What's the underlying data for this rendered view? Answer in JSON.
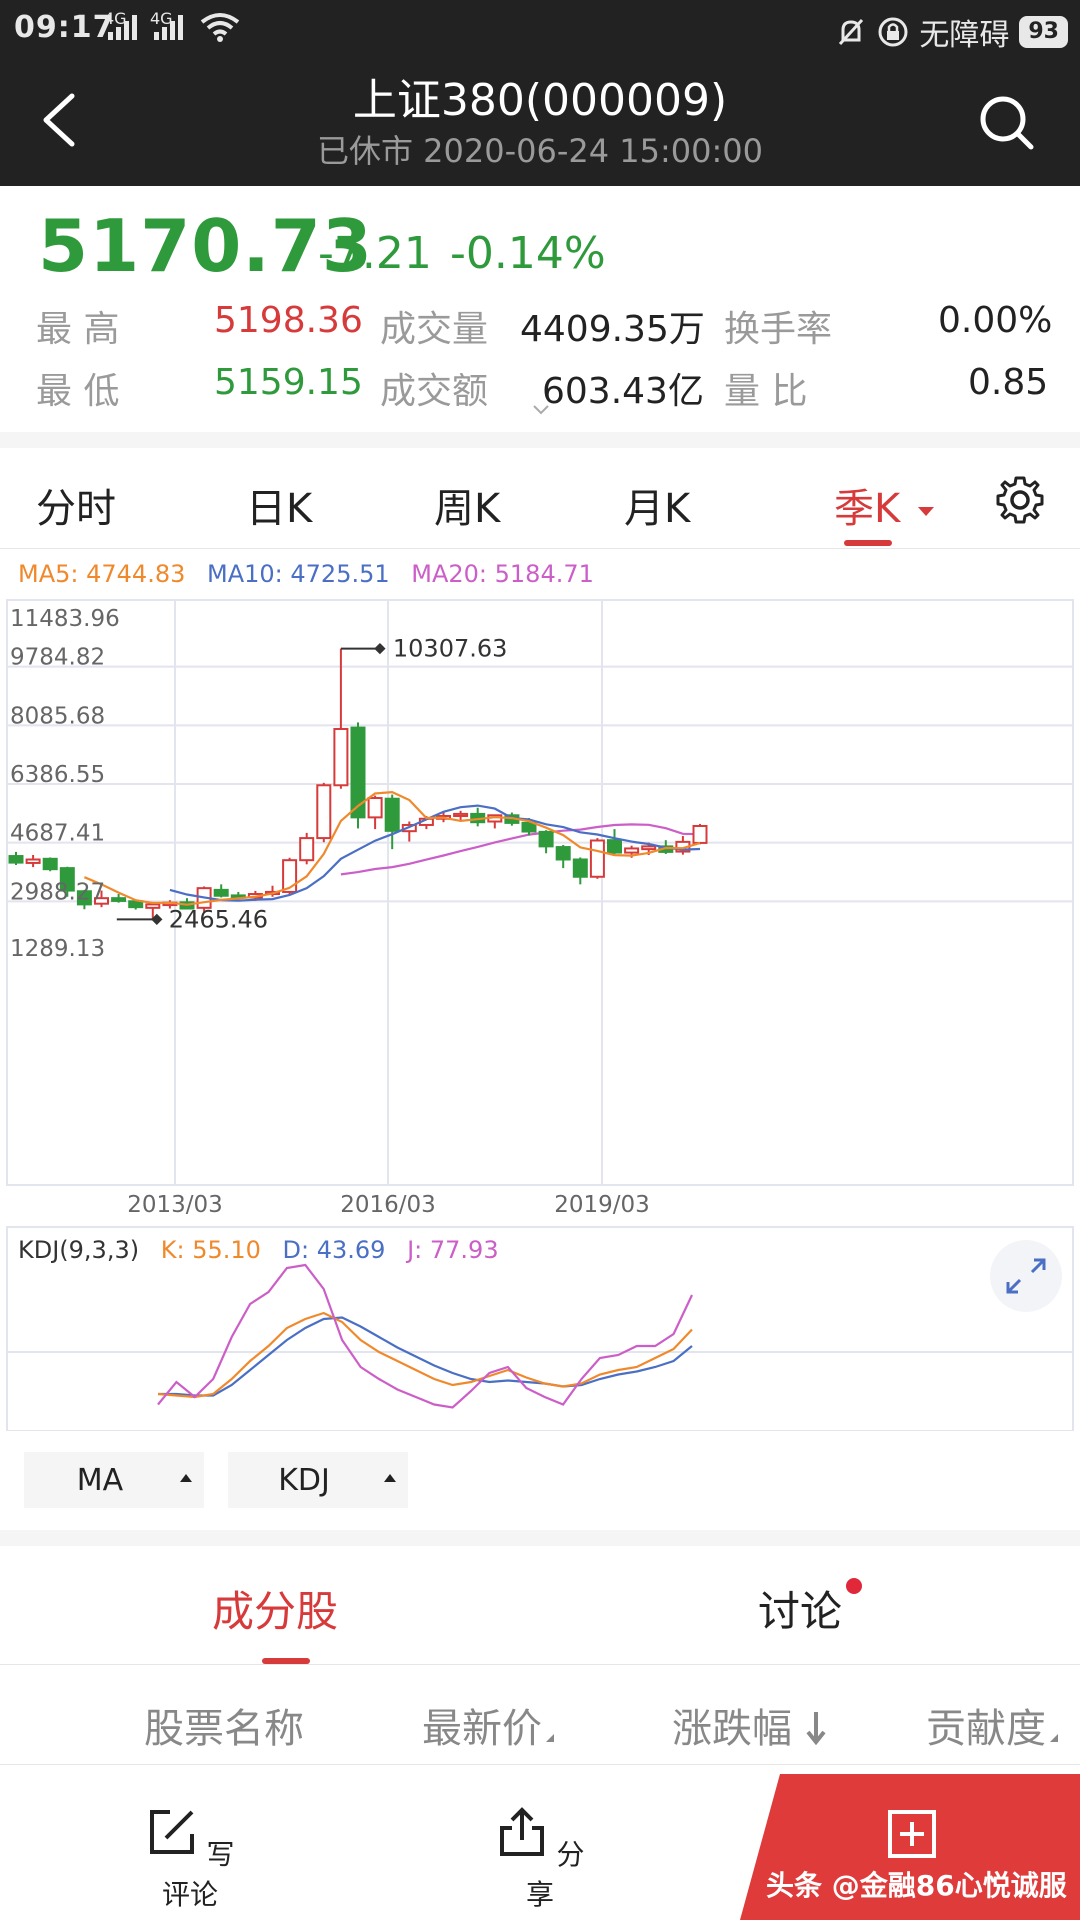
{
  "status_bar": {
    "time": "09:17",
    "network1": "4G",
    "network2": "4G",
    "accessibility_label": "无障碍",
    "battery": "93"
  },
  "header": {
    "title": "上证380(000009)",
    "subtitle": "已休市 2020-06-24 15:00:00"
  },
  "quote": {
    "price": "5170.73",
    "change": "-7.21",
    "change_pct": "-0.14%",
    "high_label": "最    高",
    "high": "5198.36",
    "low_label": "最    低",
    "low": "5159.15",
    "volume_label": "成交量",
    "volume": "4409.35万",
    "amount_label": "成交额",
    "amount": "603.43亿",
    "turnover_label": "换手率",
    "turnover": "0.00%",
    "vol_ratio_label": "量    比",
    "vol_ratio": "0.85"
  },
  "tabs": [
    "分时",
    "日K",
    "周K",
    "月K",
    "季K"
  ],
  "active_tab": "季K",
  "ma_legend": {
    "ma5": "MA5: 4744.83",
    "ma10": "MA10: 4725.51",
    "ma20": "MA20: 5184.71"
  },
  "kdj_legend": {
    "name": "KDJ(9,3,3)",
    "k": "K: 55.10",
    "d": "D: 43.69",
    "j": "J: 77.93"
  },
  "indicator_buttons": {
    "ma": "MA",
    "kdj": "KDJ"
  },
  "lower_tabs": {
    "components": "成分股",
    "discussion": "讨论"
  },
  "columns": [
    "股票名称",
    "最新价",
    "涨跌幅",
    "贡献度"
  ],
  "bottom_bar": {
    "comment": "写评论",
    "share": "分享",
    "watermark": "头条 @金融86心悦诚服"
  },
  "colors": {
    "up": "#d73a3a",
    "down": "#2f9a3c",
    "ma5": "#f0892c",
    "ma10": "#4a6fc4",
    "ma20": "#cc5ec8",
    "header_bg": "#222222"
  },
  "chart_data": {
    "type": "candlestick",
    "period": "quarterly",
    "y_ticks": [
      "11483.96",
      "9784.82",
      "8085.68",
      "6386.55",
      "4687.41",
      "2988.27",
      "1289.13"
    ],
    "ylim": [
      1289.13,
      11483.96
    ],
    "x_ticks": [
      "2013/03",
      "2016/03",
      "2019/03"
    ],
    "annotations": {
      "max": "10307.63",
      "min": "2465.46"
    },
    "candles": [
      {
        "o": 4300,
        "h": 4420,
        "l": 4040,
        "c": 4110
      },
      {
        "o": 4100,
        "h": 4330,
        "l": 3980,
        "c": 4200
      },
      {
        "o": 4220,
        "h": 4260,
        "l": 3860,
        "c": 3920
      },
      {
        "o": 3950,
        "h": 3990,
        "l": 3120,
        "c": 3300
      },
      {
        "o": 3280,
        "h": 3320,
        "l": 2760,
        "c": 2900
      },
      {
        "o": 2920,
        "h": 3300,
        "l": 2820,
        "c": 3080
      },
      {
        "o": 3080,
        "h": 3200,
        "l": 2950,
        "c": 3000
      },
      {
        "o": 2990,
        "h": 3020,
        "l": 2750,
        "c": 2820
      },
      {
        "o": 2800,
        "h": 2970,
        "l": 2470,
        "c": 2900
      },
      {
        "o": 2880,
        "h": 3020,
        "l": 2780,
        "c": 2950
      },
      {
        "o": 2960,
        "h": 3080,
        "l": 2760,
        "c": 2780
      },
      {
        "o": 2800,
        "h": 3420,
        "l": 2660,
        "c": 3370
      },
      {
        "o": 3320,
        "h": 3480,
        "l": 3100,
        "c": 3150
      },
      {
        "o": 3160,
        "h": 3260,
        "l": 3040,
        "c": 3110
      },
      {
        "o": 3100,
        "h": 3290,
        "l": 3000,
        "c": 3200
      },
      {
        "o": 3200,
        "h": 3440,
        "l": 3120,
        "c": 3260
      },
      {
        "o": 3260,
        "h": 4250,
        "l": 3200,
        "c": 4180
      },
      {
        "o": 4180,
        "h": 4970,
        "l": 4060,
        "c": 4820
      },
      {
        "o": 4820,
        "h": 6420,
        "l": 4700,
        "c": 6350
      },
      {
        "o": 6350,
        "h": 10307,
        "l": 6250,
        "c": 7980
      },
      {
        "o": 8020,
        "h": 8170,
        "l": 5100,
        "c": 5420
      },
      {
        "o": 5420,
        "h": 6050,
        "l": 5080,
        "c": 5980
      },
      {
        "o": 5960,
        "h": 6080,
        "l": 4500,
        "c": 5030
      },
      {
        "o": 5020,
        "h": 5300,
        "l": 4720,
        "c": 5200
      },
      {
        "o": 5200,
        "h": 5460,
        "l": 5080,
        "c": 5380
      },
      {
        "o": 5380,
        "h": 5580,
        "l": 5280,
        "c": 5460
      },
      {
        "o": 5460,
        "h": 5610,
        "l": 5300,
        "c": 5520
      },
      {
        "o": 5520,
        "h": 5700,
        "l": 5160,
        "c": 5280
      },
      {
        "o": 5300,
        "h": 5480,
        "l": 5100,
        "c": 5480
      },
      {
        "o": 5480,
        "h": 5560,
        "l": 5180,
        "c": 5260
      },
      {
        "o": 5260,
        "h": 5400,
        "l": 4900,
        "c": 5010
      },
      {
        "o": 5000,
        "h": 5050,
        "l": 4380,
        "c": 4580
      },
      {
        "o": 4560,
        "h": 4620,
        "l": 3950,
        "c": 4200
      },
      {
        "o": 4200,
        "h": 4260,
        "l": 3480,
        "c": 3700
      },
      {
        "o": 3700,
        "h": 4820,
        "l": 3640,
        "c": 4750
      },
      {
        "o": 4760,
        "h": 5080,
        "l": 4360,
        "c": 4400
      },
      {
        "o": 4400,
        "h": 4600,
        "l": 4250,
        "c": 4520
      },
      {
        "o": 4500,
        "h": 4690,
        "l": 4330,
        "c": 4580
      },
      {
        "o": 4580,
        "h": 4760,
        "l": 4360,
        "c": 4420
      },
      {
        "o": 4430,
        "h": 4880,
        "l": 4340,
        "c": 4710
      },
      {
        "o": 4680,
        "h": 5230,
        "l": 4640,
        "c": 5170
      }
    ],
    "kdj": {
      "ylim": [
        0,
        100
      ],
      "k": [
        12,
        11,
        10,
        12,
        22,
        34,
        44,
        56,
        62,
        66,
        60,
        48,
        40,
        34,
        28,
        22,
        18,
        20,
        24,
        28,
        23,
        19,
        17,
        19,
        25,
        28,
        30,
        36,
        42,
        55
      ],
      "d": [
        12,
        12,
        11,
        11,
        18,
        28,
        38,
        48,
        56,
        62,
        63,
        57,
        50,
        43,
        37,
        31,
        26,
        22,
        20,
        21,
        20,
        19,
        17,
        18,
        22,
        25,
        27,
        30,
        34,
        44
      ],
      "j": [
        5,
        20,
        10,
        22,
        50,
        72,
        80,
        96,
        98,
        82,
        48,
        30,
        22,
        15,
        10,
        5,
        3,
        14,
        26,
        30,
        16,
        10,
        5,
        22,
        36,
        38,
        44,
        44,
        52,
        78
      ]
    }
  }
}
